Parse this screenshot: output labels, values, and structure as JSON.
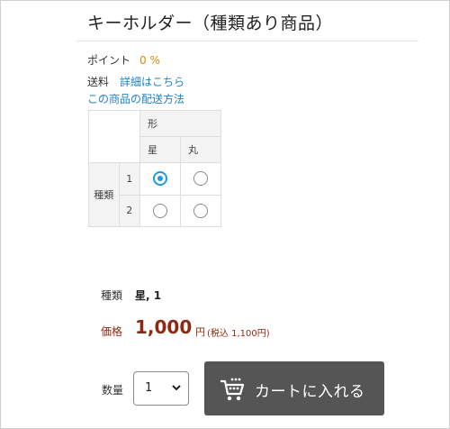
{
  "product": {
    "title": "キーホルダー（種類あり商品）"
  },
  "info": {
    "points_label": "ポイント",
    "points_value": "0 %",
    "shipping_label": "送料",
    "shipping_link": "詳細はこちら",
    "delivery_link": "この商品の配送方法"
  },
  "matrix": {
    "col_header": "形",
    "col_options": [
      "星",
      "丸"
    ],
    "row_header": "種類",
    "row_options": [
      "1",
      "2"
    ],
    "selected": {
      "row": "1",
      "col": "星"
    }
  },
  "selection": {
    "kind_label": "種類",
    "kind_value": "星, 1"
  },
  "price": {
    "label": "価格",
    "value": "1,000",
    "unit": "円",
    "tax_text": "(税込 1,100円)"
  },
  "quantity": {
    "label": "数量",
    "value": "1"
  },
  "cart": {
    "label": "カートに入れる",
    "icon": "cart-icon"
  },
  "colors": {
    "price": "#8b2a12",
    "link": "#1e82c8",
    "points": "#e08a00",
    "button": "#555555",
    "radio_selected": "#1e9be0"
  }
}
